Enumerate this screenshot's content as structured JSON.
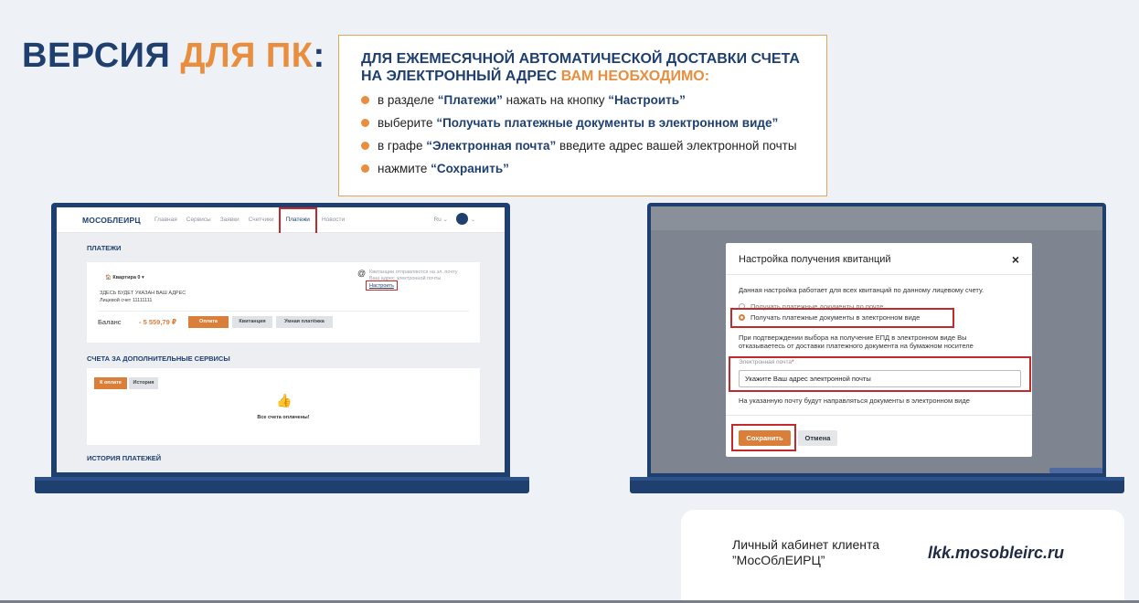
{
  "headline": {
    "part1": "ВЕРСИЯ ",
    "part2": "ДЛЯ ПК",
    "part3": ":"
  },
  "instructions": {
    "title_line1": "ДЛЯ ЕЖЕМЕСЯЧНОЙ АВТОМАТИЧЕСКОЙ ДОСТАВКИ СЧЕТА",
    "title_line2": "НА ЭЛЕКТРОННЫЙ АДРЕС ",
    "title_accent": "ВАМ НЕОБХОДИМО:",
    "steps": [
      {
        "pre": "в разделе ",
        "b1": "“Платежи”",
        "mid": " нажать на кнопку ",
        "b2": "“Настроить”",
        "post": ""
      },
      {
        "pre": "выберите ",
        "b1": "“Получать платежные документы в электронном виде”",
        "mid": "",
        "b2": "",
        "post": ""
      },
      {
        "pre": "в графе ",
        "b1": "“Электронная почта”",
        "mid": " введите адрес вашей электронной почты",
        "b2": "",
        "post": ""
      },
      {
        "pre": "нажмите ",
        "b1": "“Сохранить”",
        "mid": "",
        "b2": "",
        "post": ""
      }
    ]
  },
  "left_screen": {
    "logo": "МОСОБЛЕИРЦ",
    "menu": [
      "Главная",
      "Сервисы",
      "Заявки",
      "Счетчики",
      "Платежи",
      "Новости"
    ],
    "active_menu": "Платежи",
    "lang": "Ru ⌄",
    "section_payments": "ПЛАТЕЖИ",
    "account_name": "🏠 Квартира 0  ▾",
    "address": "ЗДЕСЬ БУДЕТ УКАЗАН ВАШ АДРЕС",
    "account_no": "Лицевой счет  11111111",
    "receipts_note_1": "Квитанции отправляются на эл. почту",
    "receipts_note_2": "Ваш адрес электронной почты",
    "configure_link": "Настроить",
    "balance_label": "Баланс",
    "balance_value": "- 5 559,79 ₽",
    "btn_pay": "Оплата",
    "btn_receipt": "Квитанция",
    "btn_smart": "Умная платёжка",
    "section_extra": "СЧЕТА ЗА ДОПОЛНИТЕЛЬНЫЕ СЕРВИСЫ",
    "tab_topay": "К оплате",
    "tab_history": "История",
    "all_paid": "Все счета оплачены!",
    "section_history": "ИСТОРИЯ ПЛАТЕЖЕЙ"
  },
  "right_screen": {
    "modal_title": "Настройка получения квитанций",
    "close": "×",
    "note": "Данная настройка работает для всех квитанций по данному лицевому счету.",
    "option_paper": "Получать платежные документы по почте",
    "option_electronic": "Получать платежные документы в электронном виде",
    "warning_1": "При подтверждении выбора на получение ЕПД в электронном виде Вы",
    "warning_2": "отказываетесь от доставки платежного документа на бумажном носителе",
    "email_label": "Электронная почта",
    "email_required": "*",
    "email_value": "Укажите Ваш адрес электронной почты",
    "email_hint": "На указанную почту будут направляться документы в электронном виде",
    "btn_save": "Сохранить",
    "btn_cancel": "Отмена"
  },
  "footer": {
    "label_line1": "Личный кабинет клиента",
    "label_line2": "”МосОблЕИРЦ”",
    "url": "lkk.mosobleirc.ru"
  },
  "colors": {
    "navy": "#1f3f6e",
    "orange": "#e88e3e",
    "highlight": "#c42a2a"
  }
}
